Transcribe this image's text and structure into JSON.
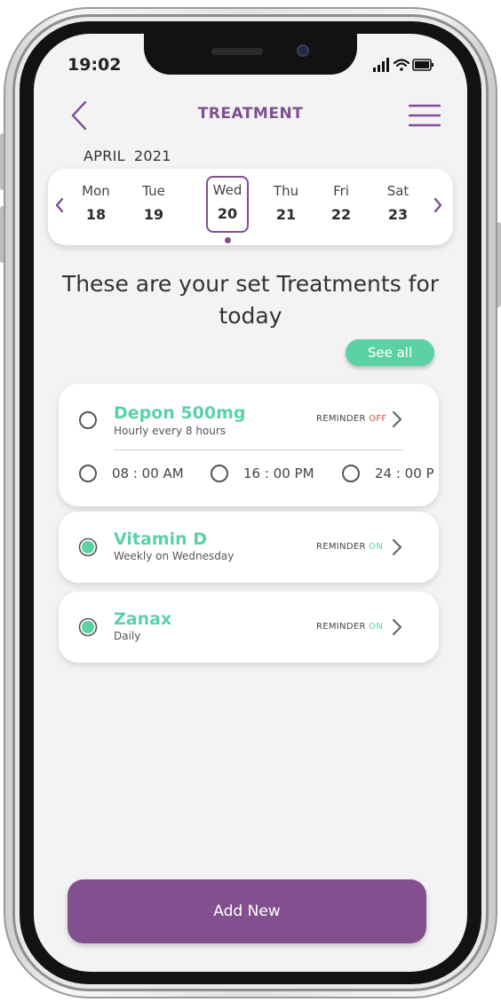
{
  "status_bar": {
    "time": "19:02"
  },
  "header": {
    "title": "TREATMENT"
  },
  "calendar": {
    "month": "APRIL",
    "year": "2021",
    "days": [
      {
        "name": "Mon",
        "num": "18"
      },
      {
        "name": "Tue",
        "num": "19"
      },
      {
        "name": "Wed",
        "num": "20",
        "selected": true
      },
      {
        "name": "Thu",
        "num": "21"
      },
      {
        "name": "Fri",
        "num": "22"
      },
      {
        "name": "Sat",
        "num": "23"
      }
    ]
  },
  "heading": "These are your set Treatments for today",
  "see_all_label": "See all",
  "treatments": [
    {
      "name": "Depon 500mg",
      "schedule": "Hourly every 8 hours",
      "reminder_label": "REMINDER",
      "reminder_state": "OFF",
      "done": false,
      "doses": [
        "08 : 00 AM",
        "16 : 00 PM",
        "24 : 00 P"
      ]
    },
    {
      "name": "Vitamin D",
      "schedule": "Weekly on  Wednesday",
      "reminder_label": "REMINDER",
      "reminder_state": "ON",
      "done": true
    },
    {
      "name": "Zanax",
      "schedule": "Daily",
      "reminder_label": "REMINDER",
      "reminder_state": "ON",
      "done": true
    }
  ],
  "add_new_label": "Add New",
  "colors": {
    "brand_purple": "#7f4f93",
    "accent_green": "#5cd1a6",
    "reminder_off": "#e04a4a"
  }
}
